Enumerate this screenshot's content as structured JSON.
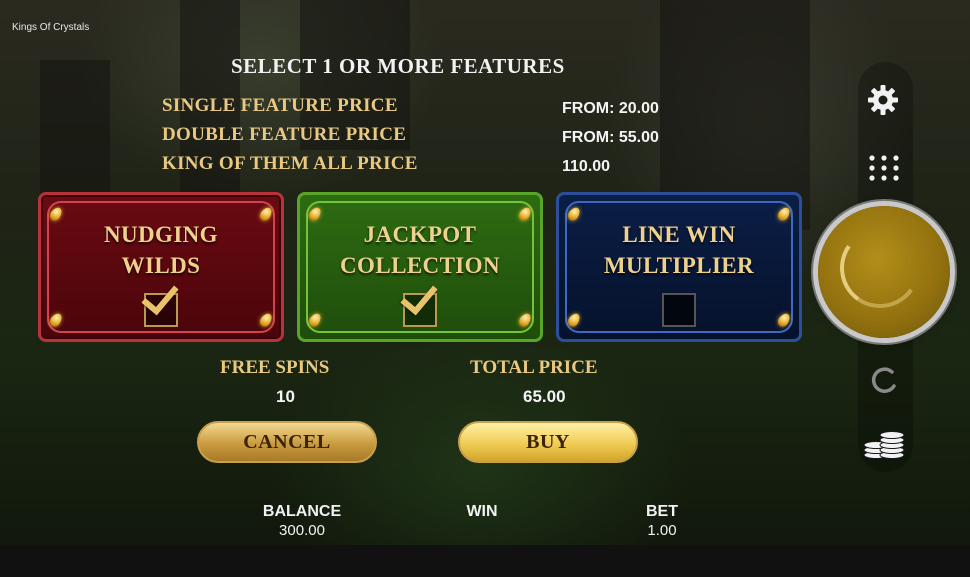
{
  "app_title": "Kings Of Crystals",
  "heading": "SELECT 1 OR MORE FEATURES",
  "prices": [
    {
      "label": "SINGLE FEATURE PRICE",
      "value": "FROM: 20.00"
    },
    {
      "label": "DOUBLE FEATURE PRICE",
      "value": "FROM: 55.00"
    },
    {
      "label": "KING OF THEM ALL PRICE",
      "value": "110.00"
    }
  ],
  "features": [
    {
      "line1": "NUDGING",
      "line2": "WILDS",
      "selected": true,
      "color": "#6a0a12"
    },
    {
      "line1": "JACKPOT",
      "line2": "COLLECTION",
      "selected": true,
      "color": "#2d6c12"
    },
    {
      "line1": "LINE WIN",
      "line2": "MULTIPLIER",
      "selected": false,
      "color": "#0b1e46"
    }
  ],
  "free_spins": {
    "label": "FREE SPINS",
    "value": "10"
  },
  "total_price": {
    "label": "TOTAL PRICE",
    "value": "65.00"
  },
  "buttons": {
    "cancel": "CANCEL",
    "buy": "BUY"
  },
  "footer": {
    "balance_label": "BALANCE",
    "balance_value": "300.00",
    "win_label": "WIN",
    "bet_label": "BET",
    "bet_value": "1.00"
  },
  "side_icons": [
    "gear-icon",
    "menu-grid-icon",
    "spin-button",
    "autoplay-icon",
    "coins-stack-icon"
  ],
  "colors": {
    "gold_text": "#e9c982",
    "spin_gold": "#94730f"
  }
}
